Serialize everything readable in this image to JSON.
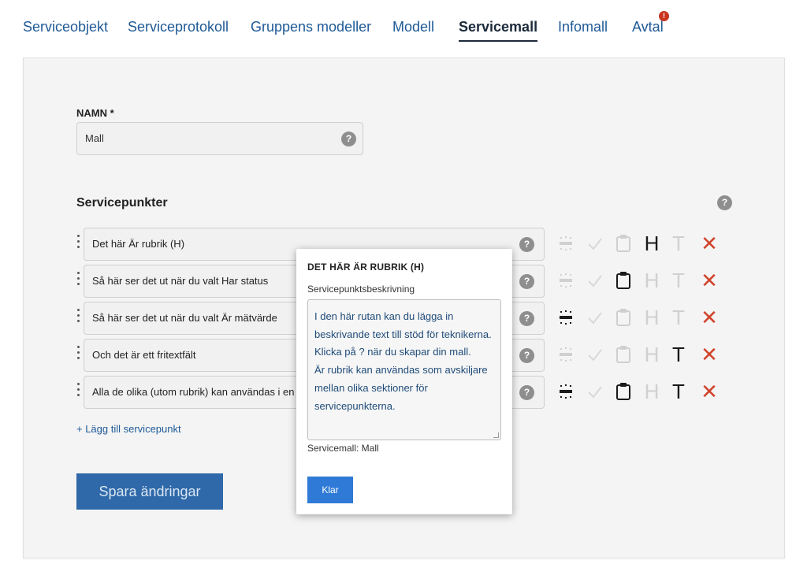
{
  "nav": {
    "tabs": [
      {
        "label": "Serviceobjekt",
        "active": false
      },
      {
        "label": "Serviceprotokoll",
        "active": false
      },
      {
        "label": "Gruppens modeller",
        "active": false
      },
      {
        "label": "Modell",
        "active": false
      },
      {
        "label": "Servicemall",
        "active": true
      },
      {
        "label": "Infomall",
        "active": false
      },
      {
        "label": "Avtal",
        "active": false
      }
    ],
    "alert_badge": "!"
  },
  "form": {
    "name_label": "NAMN *",
    "name_value": "Mall",
    "help_glyph": "?",
    "section_title": "Servicepunkter",
    "add_link": "+ Lägg till servicepunkt",
    "save_label": "Spara ändringar"
  },
  "rows": [
    {
      "text": "Det här Är rubrik (H)",
      "icons": {
        "separator": false,
        "check": false,
        "clipboard": false,
        "h": true,
        "t": false
      }
    },
    {
      "text": "Så här ser det ut när du valt Har status",
      "icons": {
        "separator": false,
        "check": false,
        "clipboard": true,
        "h": false,
        "t": false
      }
    },
    {
      "text": "Så här ser det ut när du valt Är mätvärde",
      "icons": {
        "separator": true,
        "check": false,
        "clipboard": false,
        "h": false,
        "t": false
      }
    },
    {
      "text": "Och det är ett fritextfält",
      "icons": {
        "separator": false,
        "check": false,
        "clipboard": false,
        "h": false,
        "t": true
      }
    },
    {
      "text": "Alla de olika (utom rubrik) kan användas i en",
      "icons": {
        "separator": true,
        "check": false,
        "clipboard": true,
        "h": false,
        "t": true
      }
    }
  ],
  "icon_glyphs": {
    "h": "H",
    "t": "T",
    "delete": "✕",
    "check": "✓"
  },
  "modal": {
    "title": "DET HÄR ÄR RUBRIK (H)",
    "label": "Servicepunktsbeskrivning",
    "description": "I den här rutan kan du lägga in beskrivande text till stöd för teknikerna. Klicka på ? när du skapar din mall.\nÄr rubrik kan användas som avskiljare mellan olika sektioner för servicepunkterna.",
    "footer": "Servicemall: Mall",
    "button": "Klar"
  },
  "colors": {
    "accent": "#1f5a96",
    "save_button": "#2f69a9",
    "modal_button": "#2f7ad6",
    "delete": "#d0442b",
    "alert": "#c8341f"
  }
}
